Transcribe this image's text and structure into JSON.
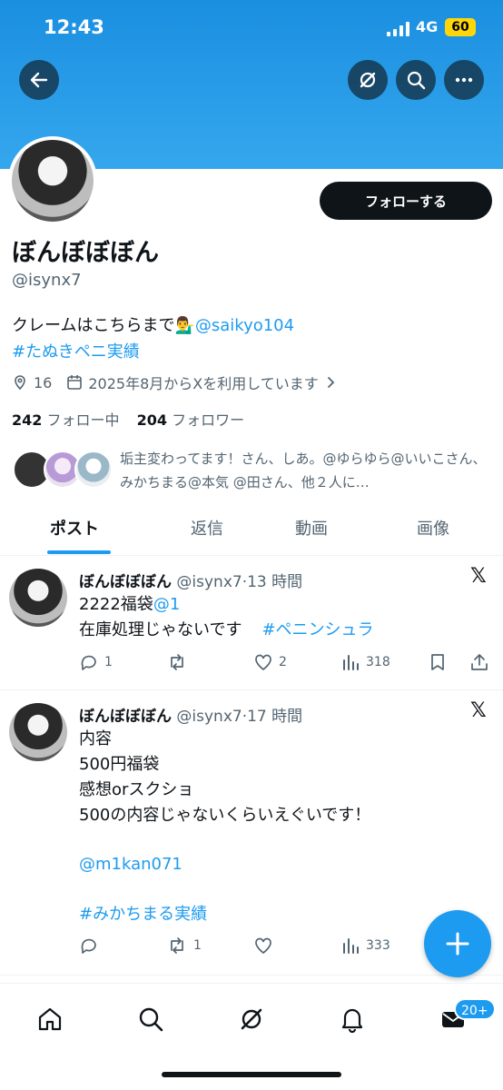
{
  "status_bar": {
    "time": "12:43",
    "network": "4G",
    "battery": "60"
  },
  "profile": {
    "display_name": "ぼんぼぼぼん",
    "handle": "@isynx7",
    "follow_label": "フォローする",
    "bio_line1_text": "クレームはこちらまで💁‍♂️",
    "bio_line1_mention": "@saikyo104",
    "bio_line2_hashtag": "#たぬきペニ実績",
    "location": "16",
    "joined": "2025年8月からXを利用しています",
    "following_count": "242",
    "following_label": "フォロー中",
    "followers_count": "204",
    "followers_label": "フォロワー",
    "followed_by": "垢主変わってます！さん、しあ。@ゆらゆら@いいこさん、みかちまる@本気 @田さん、他２人に…"
  },
  "tabs": [
    "ポスト",
    "返信",
    "動画",
    "画像"
  ],
  "posts": [
    {
      "name": "ぼんぼぼぼん",
      "meta": "@isynx7·13 時間",
      "line1": "2222福袋",
      "line1_mention": "@1",
      "line2": "在庫処理じゃないです",
      "line2_hashtag": "#ペニンシュラ",
      "replies": "1",
      "reposts": "",
      "likes": "2",
      "views": "318"
    },
    {
      "name": "ぼんぼぼぼん",
      "meta": "@isynx7·17 時間",
      "body": "内容\n500円福袋\n感想orスクショ\n500の内容じゃないくらいえぐいです！",
      "mention": "@m1kan071",
      "hashtag": "#みかちまる実績",
      "replies": "",
      "reposts": "1",
      "likes": "",
      "views": "333"
    }
  ],
  "nav": {
    "messages_badge": "20+"
  },
  "colors": {
    "banner": "#1a8fe0",
    "accent": "#1d9bf0",
    "text": "#0f1419",
    "secondary": "#536471"
  }
}
